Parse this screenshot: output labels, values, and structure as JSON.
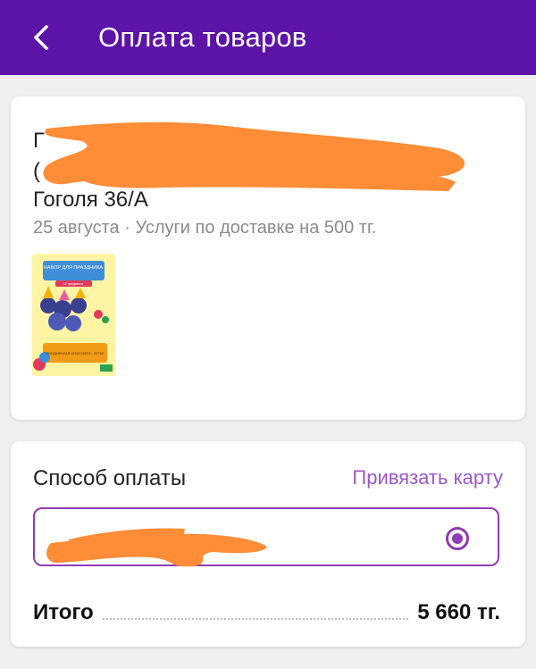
{
  "header": {
    "title": "Оплата товаров",
    "back_icon": "chevron-left-icon",
    "background_color": "#5d12a8"
  },
  "order": {
    "address_line3": "Гоголя 36/А",
    "delivery_info": "25 августа · Услуги по доставке на 500 тг.",
    "product_image": {
      "title": "НАБОР ДЛЯ ПРАЗДНИКА",
      "badge": "12 предметов",
      "footer": "ПРАЗДНИЧНАЯ АТМОСФЕРА - ЛЕГКО"
    }
  },
  "payment": {
    "label": "Способ оплаты",
    "link_card": "Привязать карту",
    "selected": true,
    "accent_color": "#8e3db5"
  },
  "total": {
    "label": "Итого",
    "value": "5 660 тг."
  }
}
